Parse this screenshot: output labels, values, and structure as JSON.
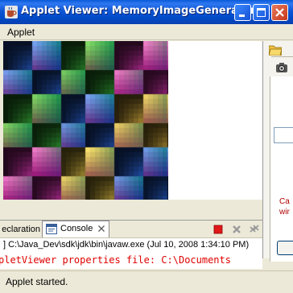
{
  "window": {
    "title": "Applet Viewer: MemoryImageGenerator....",
    "accent": "#0a5bd8"
  },
  "menu": {
    "applet_label": "Applet"
  },
  "applet": {
    "description": "gradient checkerboard",
    "colors": [
      "#2f6ff0",
      "#3fc43f",
      "#f43fc8",
      "#f7d64a",
      "#ff3a3a",
      "#72f0d6",
      "#ffffff"
    ]
  },
  "right_panel": {
    "red_text_line1": "Ca",
    "red_text_line2": "wir",
    "icons": [
      "folder-icon",
      "camera-icon"
    ]
  },
  "console": {
    "tabs": [
      {
        "label": "eclaration"
      },
      {
        "label": "Console"
      }
    ],
    "path_text": "] C:\\Java_Dev\\sdk\\jdk\\bin\\javaw.exe (Jul 10, 2008 1:34:10 PM)",
    "output_text": "pletViewer properties file: C:\\Documents",
    "toolbar_icons": [
      "terminate-icon",
      "remove-launch-icon",
      "remove-all-icon"
    ]
  },
  "status": {
    "text": "Applet started."
  }
}
